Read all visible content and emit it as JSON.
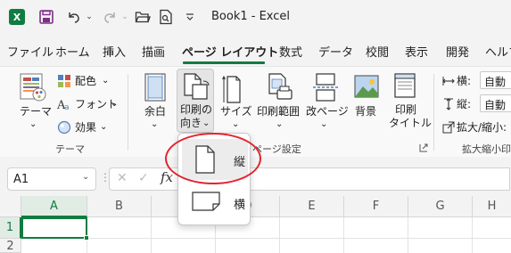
{
  "titlebar": {
    "app_icon_letter": "X",
    "title": "Book1  -  Excel"
  },
  "tabs": [
    "ファイル",
    "ホーム",
    "挿入",
    "描画",
    "ページ レイアウト",
    "数式",
    "データ",
    "校閲",
    "表示",
    "開発",
    "ヘルプ"
  ],
  "active_tab": "ページ レイアウト",
  "ribbon": {
    "theme_group": {
      "themes_label": "テーマ",
      "colors_label": "配色",
      "fonts_label": "フォント",
      "effects_label": "効果",
      "group_label": "テーマ"
    },
    "page_setup_group": {
      "margins_label": "余白",
      "orientation_label_1": "印刷の",
      "orientation_label_2": "向き",
      "size_label": "サイズ",
      "print_area_label": "印刷範囲",
      "breaks_label": "改ページ",
      "background_label": "背景",
      "print_titles_label_1": "印刷",
      "print_titles_label_2": "タイトル",
      "group_label": "ページ設定"
    },
    "scale_group": {
      "width_label": "横:",
      "width_value": "自動",
      "height_label": "縦:",
      "height_value": "自動",
      "scale_label": "拡大/縮小:",
      "group_label": "拡大縮小印"
    }
  },
  "formula_bar": {
    "name_box": "A1",
    "fx_label": "fx"
  },
  "grid": {
    "columns": [
      "A",
      "B",
      "C",
      "D",
      "E",
      "F",
      "G",
      "H"
    ],
    "rows": [
      "1",
      "2"
    ],
    "active_cell": "A1"
  },
  "orientation_menu": {
    "items": [
      {
        "label": "縦",
        "icon": "portrait-page-icon"
      },
      {
        "label": "横",
        "icon": "landscape-page-icon"
      }
    ]
  },
  "colors": {
    "excel_green": "#107c41",
    "highlight_red": "#e3232d"
  }
}
